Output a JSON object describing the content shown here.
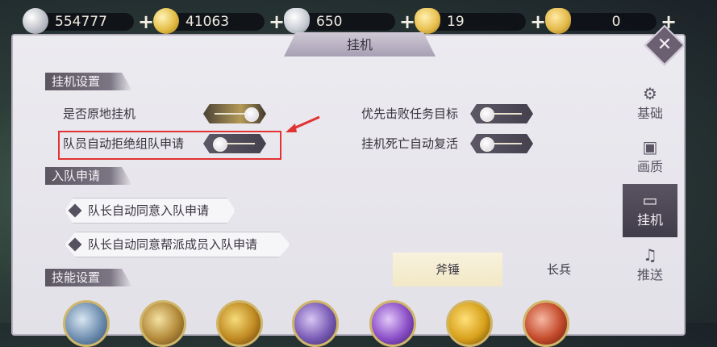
{
  "currencies": [
    {
      "value": "554777",
      "icon": "silver-coin-icon",
      "color": "#d7d9df"
    },
    {
      "value": "41063",
      "icon": "gold-coin-icon",
      "color": "#e6c24a"
    },
    {
      "value": "650",
      "icon": "silver-ingot-icon",
      "color": "#cfd2d8"
    },
    {
      "value": "19",
      "icon": "gold-ingot-icon",
      "color": "#e8c04f"
    },
    {
      "value": "0",
      "icon": "gold-ingot-small-icon",
      "color": "#e3b94a"
    }
  ],
  "panel": {
    "title": "挂机"
  },
  "afk_settings": {
    "header": "挂机设置",
    "options": [
      {
        "label": "是否原地挂机",
        "state": "on"
      },
      {
        "label": "优先击败任务目标",
        "state": "off"
      },
      {
        "label": "队员自动拒绝组队申请",
        "state": "off"
      },
      {
        "label": "挂机死亡自动复活",
        "state": "off"
      }
    ]
  },
  "team_join": {
    "header": "入队申请",
    "options": [
      {
        "label": "队长自动同意入队申请"
      },
      {
        "label": "队长自动同意帮派成员入队申请"
      }
    ]
  },
  "skills": {
    "header": "技能设置",
    "tabs": [
      {
        "label": "斧锤",
        "active": true
      },
      {
        "label": "长兵",
        "active": false
      }
    ],
    "icons": [
      "skill-icon",
      "skill-icon",
      "skill-icon",
      "skill-icon",
      "skill-icon",
      "skill-icon",
      "skill-icon"
    ]
  },
  "sidenav": [
    {
      "label": "基础",
      "icon": "gear-icon",
      "active": false
    },
    {
      "label": "画质",
      "icon": "picture-icon",
      "active": false
    },
    {
      "label": "挂机",
      "icon": "monitor-icon",
      "active": true
    },
    {
      "label": "推送",
      "icon": "bell-icon",
      "active": false
    }
  ],
  "colors": {
    "highlight_box": "#e23232",
    "toggle_on": "#b59a58",
    "active_nav": "#4b4654"
  }
}
